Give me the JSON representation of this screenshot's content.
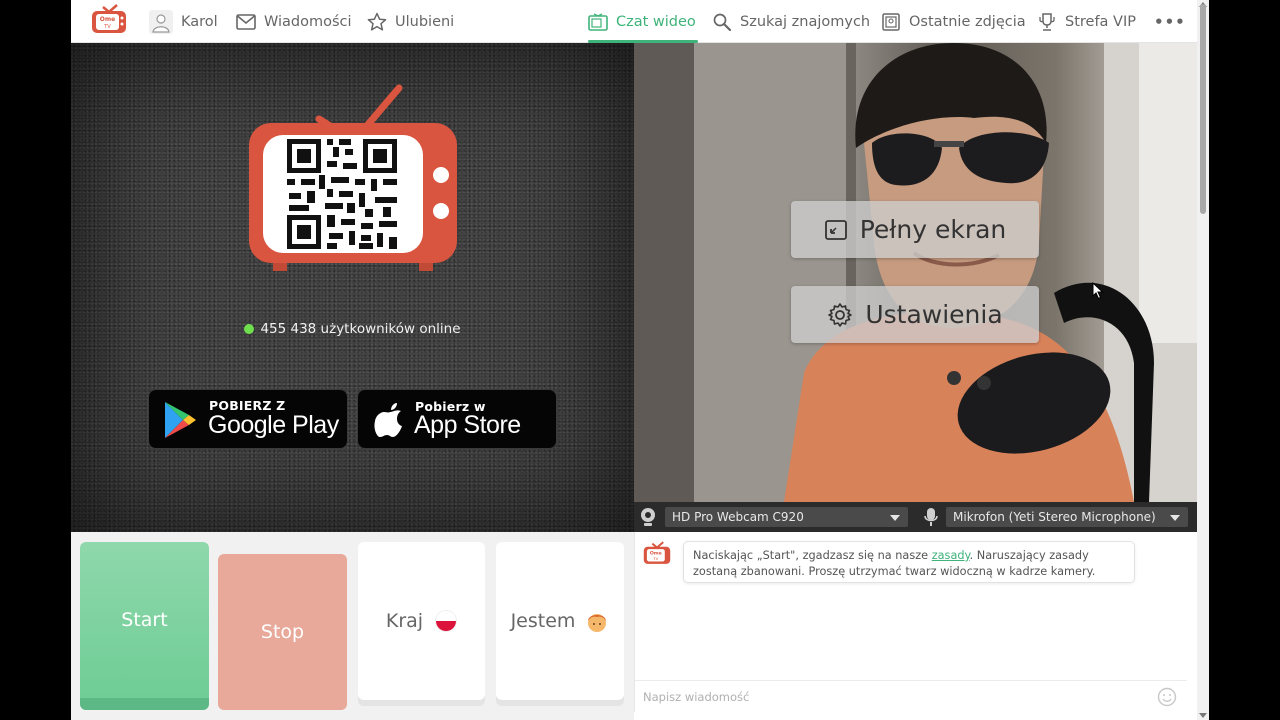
{
  "nav": {
    "user": "Karol",
    "messages": "Wiadomości",
    "favorites": "Ulubieni",
    "video_chat": "Czat wideo",
    "find_friends": "Szukaj znajomych",
    "recent_photos": "Ostatnie zdjęcia",
    "vip": "Strefa VIP",
    "more": "•••"
  },
  "left_panel": {
    "online_text": "455 438 użytkowników online",
    "google_play": {
      "small": "POBIERZ Z",
      "big": "Google Play"
    },
    "app_store": {
      "small": "Pobierz w",
      "big": "App Store"
    }
  },
  "video_overlay": {
    "fullscreen": "Pełny ekran",
    "settings": "Ustawienia"
  },
  "devices": {
    "camera": "HD Pro Webcam C920",
    "microphone": "Mikrofon (Yeti Stereo Microphone)"
  },
  "controls": {
    "start": "Start",
    "stop": "Stop",
    "country": "Kraj",
    "gender": "Jestem"
  },
  "chat": {
    "notice_before": "Naciskając „Start\", zgadzasz się na nasze ",
    "notice_link": "zasady",
    "notice_after": ". Naruszający zasady zostaną zbanowani. Proszę utrzymać twarz widoczną w kadrze kamery.",
    "placeholder": "Napisz wiadomość"
  },
  "colors": {
    "accent": "#3fb37a",
    "start": "#7dd3a0",
    "stop": "#e8a99a",
    "online_dot": "#6fe04d",
    "brand_red": "#d9553f"
  }
}
